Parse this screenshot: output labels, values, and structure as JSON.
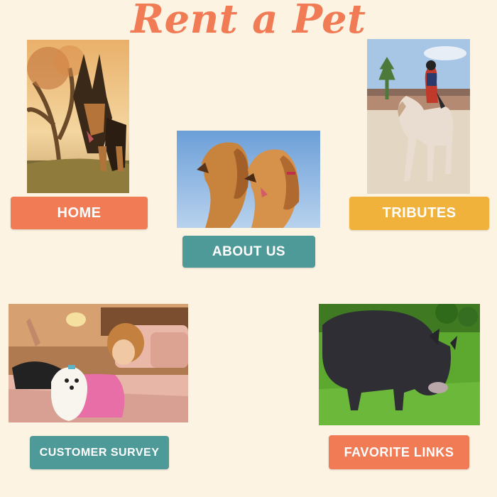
{
  "site": {
    "title": "Rent a Pet"
  },
  "nav": {
    "home": {
      "label": "HOME",
      "color": "#f07b55"
    },
    "about": {
      "label": "ABOUT US",
      "color": "#4e9a98"
    },
    "tributes": {
      "label": "TRIBUTES",
      "color": "#f0b23a"
    },
    "survey": {
      "label": "CUSTOMER SURVEY",
      "color": "#4e9a98"
    },
    "links": {
      "label": "FAVORITE LINKS",
      "color": "#f07b55"
    }
  },
  "photos": {
    "german_shepherd": "german-shepherd-photo",
    "spaniels": "cocker-spaniels-photo",
    "horse": "child-on-horse-photo",
    "woman_dog": "woman-with-dog-photo",
    "pig": "pot-bellied-pig-photo"
  },
  "colors": {
    "background": "#fdf3e3",
    "title": "#f07b55"
  }
}
